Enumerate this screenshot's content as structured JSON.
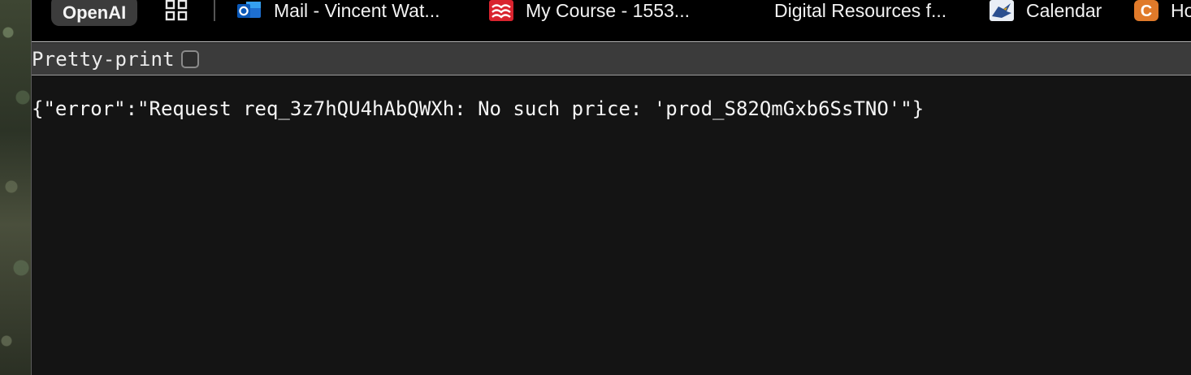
{
  "bookmarks": {
    "openai": {
      "label": "OpenAI"
    },
    "apps": {
      "icon": "apps-grid-icon"
    },
    "mail": {
      "label": "Mail - Vincent Wat...",
      "icon": "outlook-icon"
    },
    "course": {
      "label": "My Course - 1553...",
      "icon": "mcgraw-hill-icon"
    },
    "digital": {
      "label": "Digital Resources f..."
    },
    "calendar": {
      "label": "Calendar",
      "icon": "eagle-icon"
    },
    "ho": {
      "label": "Ho",
      "icon": "canvas-c-icon"
    }
  },
  "toolbar": {
    "pretty_print_label": "Pretty-print",
    "pretty_print_checked": false
  },
  "content": {
    "json_text": "{\"error\":\"Request req_3z7hQU4hAbQWXh: No such price: 'prod_S82QmGxb6SsTNO'\"}"
  },
  "colors": {
    "background": "#141414",
    "bookmarks_bar": "#000000",
    "toolbar": "#3b3b3b",
    "text": "#f5f5f5"
  }
}
